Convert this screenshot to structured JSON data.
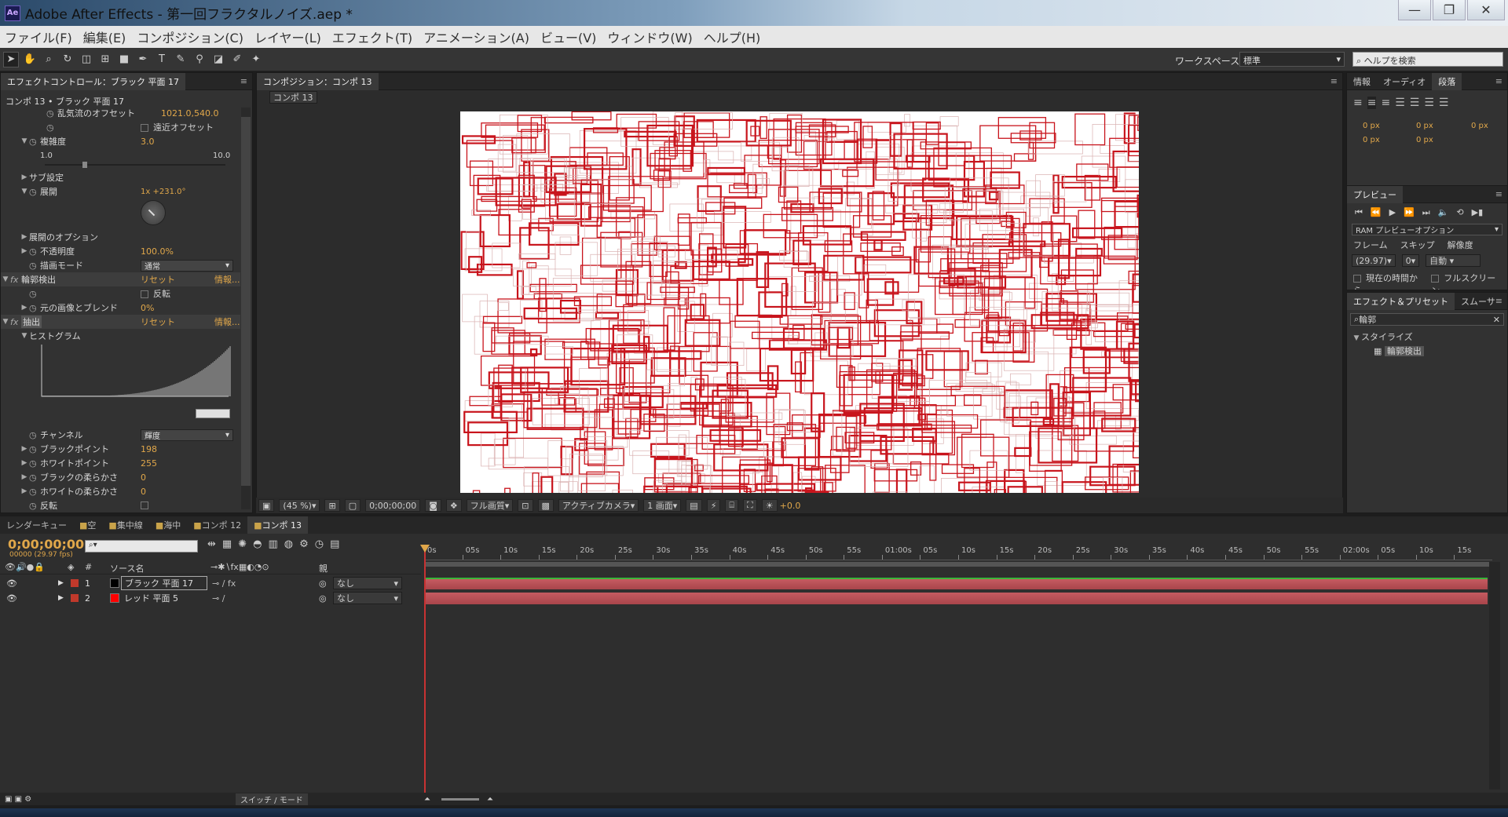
{
  "window": {
    "title": "Adobe After Effects - 第一回フラクタルノイズ.aep *",
    "logo": "Ae",
    "min": "—",
    "max": "❐",
    "close": "✕"
  },
  "menu": [
    "ファイル(F)",
    "編集(E)",
    "コンポジション(C)",
    "レイヤー(L)",
    "エフェクト(T)",
    "アニメーション(A)",
    "ビュー(V)",
    "ウィンドウ(W)",
    "ヘルプ(H)"
  ],
  "toolbar": {
    "workspace_label": "ワークスペース：",
    "workspace_value": "標準",
    "help_placeholder": "ヘルプを検索"
  },
  "effect_controls": {
    "tab": "エフェクトコントロール：ブラック 平面 17",
    "crumb": "コンポ 13 • ブラック 平面 17",
    "rows": {
      "offset_label": "乱気流のオフセット",
      "offset_val": "1021.0,540.0",
      "perspective": "遠近オフセット",
      "complexity_label": "複雑度",
      "complexity_val": "3.0",
      "slider_min": "1.0",
      "slider_max": "10.0",
      "sub": "サブ設定",
      "evolution_label": "展開",
      "evolution_val": "1x +231.0°",
      "evo_opts": "展開のオプション",
      "opacity_label": "不透明度",
      "opacity_val": "100.0%",
      "blend_label": "描画モード",
      "blend_val": "通常",
      "fx1": "輪郭検出",
      "reset": "リセット",
      "info": "情報...",
      "invert": "反転",
      "blend_orig_label": "元の画像とブレンド",
      "blend_orig_val": "0%",
      "fx2": "抽出",
      "histogram": "ヒストグラム",
      "channel_label": "チャンネル",
      "channel_val": "輝度",
      "black_pt_label": "ブラックポイント",
      "black_pt_val": "198",
      "white_pt_label": "ホワイトポイント",
      "white_pt_val": "255",
      "black_soft_label": "ブラックの柔らかさ",
      "black_soft_val": "0",
      "white_soft_label": "ホワイトの柔らかさ",
      "white_soft_val": "0",
      "invert2": "反転"
    }
  },
  "composition": {
    "tab": "コンポジション：コンポ 13",
    "sub": "コンポ 13",
    "zoom": "(45 %)",
    "time": "0;00;00;00",
    "quality": "フル画質",
    "camera": "アクティブカメラ",
    "views": "1 画面",
    "exposure": "+0.0"
  },
  "info_panel": {
    "tabs": [
      "情報",
      "オーディオ",
      "段落"
    ],
    "px": [
      "0 px",
      "0 px",
      "0 px",
      "0 px",
      "0 px"
    ]
  },
  "preview": {
    "tab": "プレビュー",
    "ram": "RAM プレビューオプション",
    "frame_label": "フレーム",
    "skip_label": "スキップ",
    "res_label": "解像度",
    "frame_val": "(29.97)",
    "skip_val": "0",
    "res_val": "自動",
    "from_current": "現在の時間から",
    "fullscreen": "フルスクリーン"
  },
  "effects_presets": {
    "tabs": [
      "エフェクト＆プリセット",
      "スムーサ"
    ],
    "search": "輪郭",
    "group": "スタイライズ",
    "item": "輪郭検出"
  },
  "timeline": {
    "tabs": [
      "レンダーキュー",
      "空",
      "集中線",
      "海中",
      "コンポ 12",
      "コンポ 13"
    ],
    "time": "0;00;00;00",
    "fps": "00000 (29.97 fps)",
    "col_source": "ソース名",
    "col_parent": "親",
    "ruler": [
      "0s",
      "05s",
      "10s",
      "15s",
      "20s",
      "25s",
      "30s",
      "35s",
      "40s",
      "45s",
      "50s",
      "55s",
      "01:00s",
      "05s",
      "10s",
      "15s",
      "20s",
      "25s",
      "30s",
      "35s",
      "40s",
      "45s",
      "50s",
      "55s",
      "02:00s",
      "05s",
      "10s",
      "15s"
    ],
    "layers": [
      {
        "num": "1",
        "name": "ブラック 平面 17",
        "color": "#000000",
        "label": "#c0392b",
        "parent": "なし"
      },
      {
        "num": "2",
        "name": "レッド 平面 5",
        "color": "#ff0000",
        "label": "#c0392b",
        "parent": "なし"
      }
    ],
    "switch_mode": "スイッチ / モード"
  }
}
